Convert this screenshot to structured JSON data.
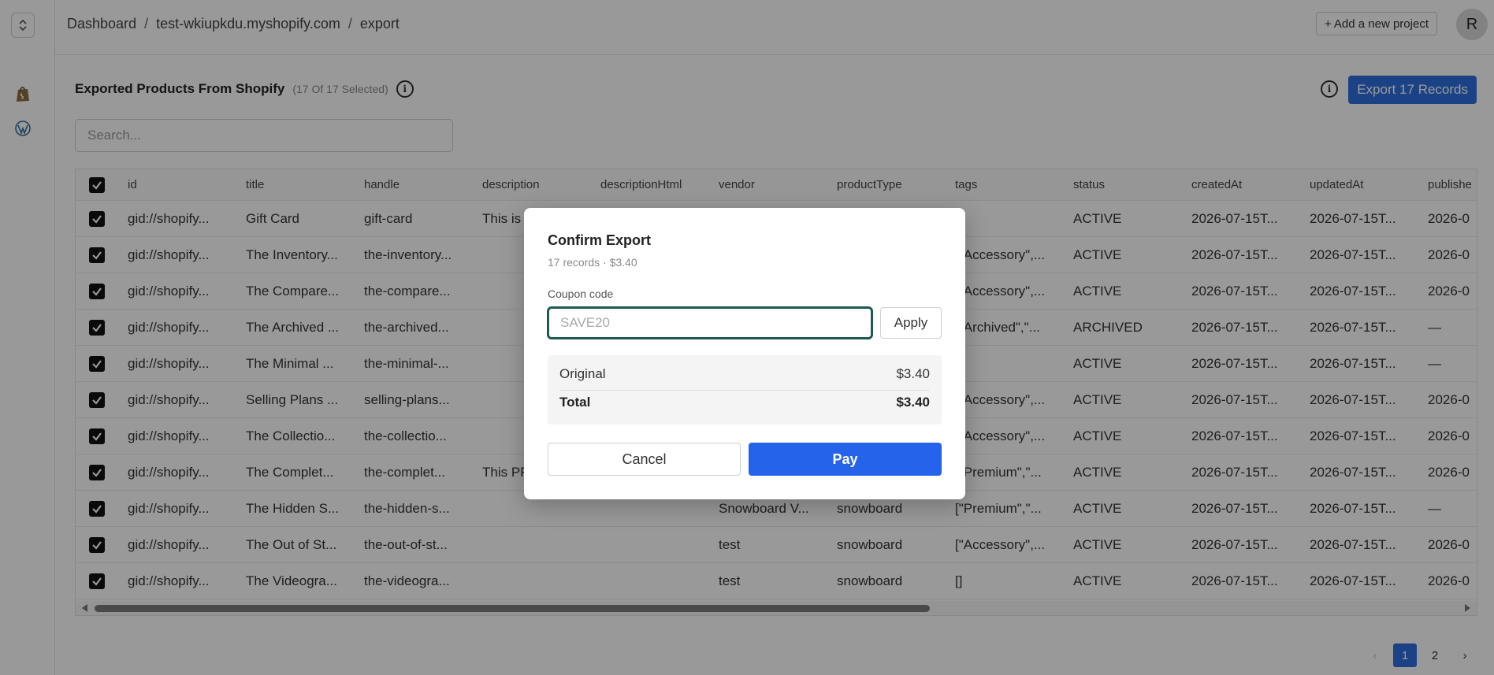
{
  "breadcrumb": {
    "items": [
      "Dashboard",
      "test-wkiupkdu.myshopify.com",
      "export"
    ]
  },
  "header": {
    "add_project_label": "+ Add a new project",
    "avatar_initial": "R"
  },
  "page": {
    "title": "Exported Products From Shopify",
    "subtitle": "(17 Of 17 Selected)",
    "export_button_label": "Export 17 Records",
    "search_placeholder": "Search..."
  },
  "table": {
    "columns": [
      "id",
      "title",
      "handle",
      "description",
      "descriptionHtml",
      "vendor",
      "productType",
      "tags",
      "status",
      "createdAt",
      "updatedAt",
      "publishe"
    ],
    "rows": [
      [
        "gid://shopify...",
        "Gift Card",
        "gift-card",
        "This is",
        "",
        "",
        "",
        "",
        "ACTIVE",
        "2026-07-15T...",
        "2026-07-15T...",
        "2026-0"
      ],
      [
        "gid://shopify...",
        "The Inventory...",
        "the-inventory...",
        "",
        "",
        "",
        "",
        "[\"Accessory\",...",
        "ACTIVE",
        "2026-07-15T...",
        "2026-07-15T...",
        "2026-0"
      ],
      [
        "gid://shopify...",
        "The Compare...",
        "the-compare...",
        "",
        "",
        "",
        "",
        "[\"Accessory\",...",
        "ACTIVE",
        "2026-07-15T...",
        "2026-07-15T...",
        "2026-0"
      ],
      [
        "gid://shopify...",
        "The Archived ...",
        "the-archived...",
        "",
        "",
        "",
        "",
        "[\"Archived\",\"...",
        "ARCHIVED",
        "2026-07-15T...",
        "2026-07-15T...",
        "—"
      ],
      [
        "gid://shopify...",
        "The Minimal ...",
        "the-minimal-...",
        "",
        "",
        "",
        "",
        "",
        "ACTIVE",
        "2026-07-15T...",
        "2026-07-15T...",
        "—"
      ],
      [
        "gid://shopify...",
        "Selling Plans ...",
        "selling-plans...",
        "",
        "",
        "",
        "",
        "[\"Accessory\",...",
        "ACTIVE",
        "2026-07-15T...",
        "2026-07-15T...",
        "2026-0"
      ],
      [
        "gid://shopify...",
        "The Collectio...",
        "the-collectio...",
        "",
        "",
        "",
        "",
        "[\"Accessory\",...",
        "ACTIVE",
        "2026-07-15T...",
        "2026-07-15T...",
        "2026-0"
      ],
      [
        "gid://shopify...",
        "The Complet...",
        "the-complet...",
        "This PR",
        "",
        "",
        "",
        "[\"Premium\",\"...",
        "ACTIVE",
        "2026-07-15T...",
        "2026-07-15T...",
        "2026-0"
      ],
      [
        "gid://shopify...",
        "The Hidden S...",
        "the-hidden-s...",
        "",
        "",
        "Snowboard V...",
        "snowboard",
        "[\"Premium\",\"...",
        "ACTIVE",
        "2026-07-15T...",
        "2026-07-15T...",
        "—"
      ],
      [
        "gid://shopify...",
        "The Out of St...",
        "the-out-of-st...",
        "",
        "",
        "test",
        "snowboard",
        "[\"Accessory\",...",
        "ACTIVE",
        "2026-07-15T...",
        "2026-07-15T...",
        "2026-0"
      ],
      [
        "gid://shopify...",
        "The Videogra...",
        "the-videogra...",
        "",
        "",
        "test",
        "snowboard",
        "[]",
        "ACTIVE",
        "2026-07-15T...",
        "2026-07-15T...",
        "2026-0"
      ]
    ]
  },
  "pagination": {
    "pages": [
      "1",
      "2"
    ],
    "current": "1"
  },
  "modal": {
    "title": "Confirm Export",
    "subtitle": "17 records · $3.40",
    "coupon_label": "Coupon code",
    "coupon_placeholder": "SAVE20",
    "apply_label": "Apply",
    "original_label": "Original",
    "original_value": "$3.40",
    "total_label": "Total",
    "total_value": "$3.40",
    "cancel_label": "Cancel",
    "pay_label": "Pay"
  },
  "icons": {
    "rail_toggle": "chevron-updown-icon",
    "shopify": "shopify-bag-icon",
    "wordpress": "wordpress-icon",
    "info": "info-icon",
    "checkbox": "checkbox-checked-icon"
  },
  "colors": {
    "accent": "#2f6fe0",
    "pay": "#2563eb",
    "input_focus": "#1f5a52"
  }
}
